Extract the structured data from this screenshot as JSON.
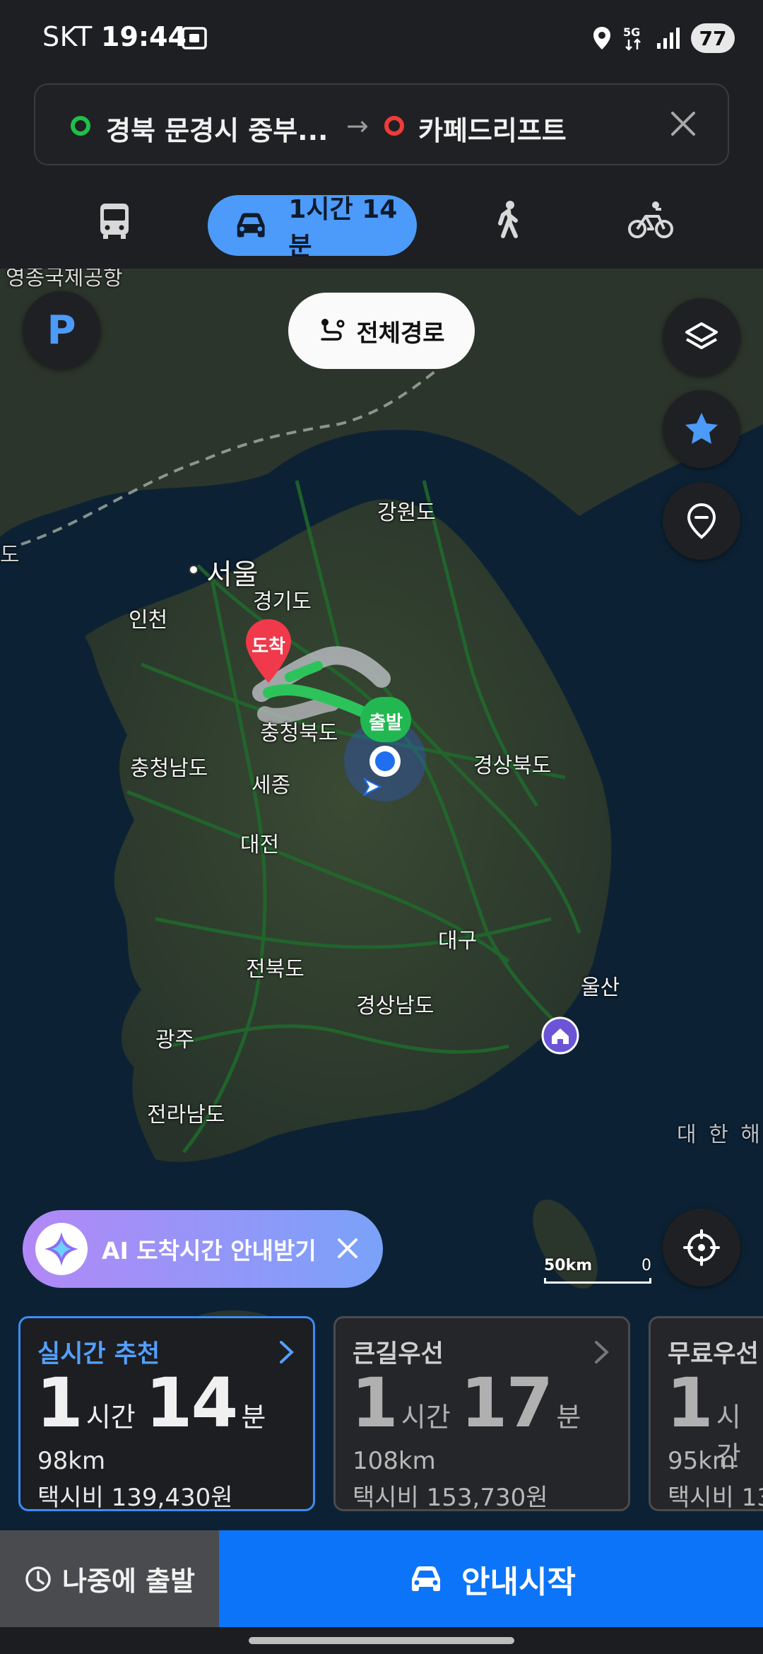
{
  "status_bar": {
    "carrier": "SKT",
    "time": "19:44",
    "network": "5G",
    "battery": "77"
  },
  "route": {
    "origin": "경북 문경시 중부...",
    "destination": "카페드리프트"
  },
  "modes": {
    "active_duration": "1시간 14분",
    "items": [
      "bus-icon",
      "car-icon",
      "walk-icon",
      "bike-icon"
    ]
  },
  "map": {
    "full_route_label": "전체경로",
    "parking_label": "P",
    "arrival_marker": "도착",
    "departure_marker": "출발",
    "labels": {
      "top_left": "영종국제공항",
      "gangwon": "강원도",
      "seoul": "서울",
      "gyeonggi": "경기도",
      "incheon": "인천",
      "chungbuk": "충청북도",
      "chungnam": "충청남도",
      "sejong": "세종",
      "daejeon": "대전",
      "gyeongbuk": "경상북도",
      "daegu": "대구",
      "jeonbuk": "전북도",
      "ulsan": "울산",
      "gyeongnam": "경상남도",
      "gwangju": "광주",
      "jeonnam": "전라남도",
      "sea": "대 한 해 협",
      "left_edge": "도"
    },
    "ai_banner": "AI 도착시간 안내받기",
    "scale_label": "50km",
    "scale_zero": "0"
  },
  "cards": [
    {
      "title": "실시간 추천",
      "hours": "1",
      "hours_unit": "시간",
      "minutes": "14",
      "minutes_unit": "분",
      "distance": "98km",
      "fare": "택시비 139,430원",
      "selected": true
    },
    {
      "title": "큰길우선",
      "hours": "1",
      "hours_unit": "시간",
      "minutes": "17",
      "minutes_unit": "분",
      "distance": "108km",
      "fare": "택시비 153,730원",
      "selected": false
    },
    {
      "title": "무료우선",
      "hours": "1",
      "hours_unit": "시간",
      "minutes": "",
      "minutes_unit": "",
      "distance": "95km",
      "fare": "택시비 13",
      "selected": false
    }
  ],
  "actions": {
    "later_label": "나중에 출발",
    "start_label": "안내시작"
  },
  "colors": {
    "accent": "#4c9bfa",
    "start_button": "#0c74f8",
    "origin_dot": "#1fbf4a",
    "dest_dot": "#f03b3b"
  }
}
